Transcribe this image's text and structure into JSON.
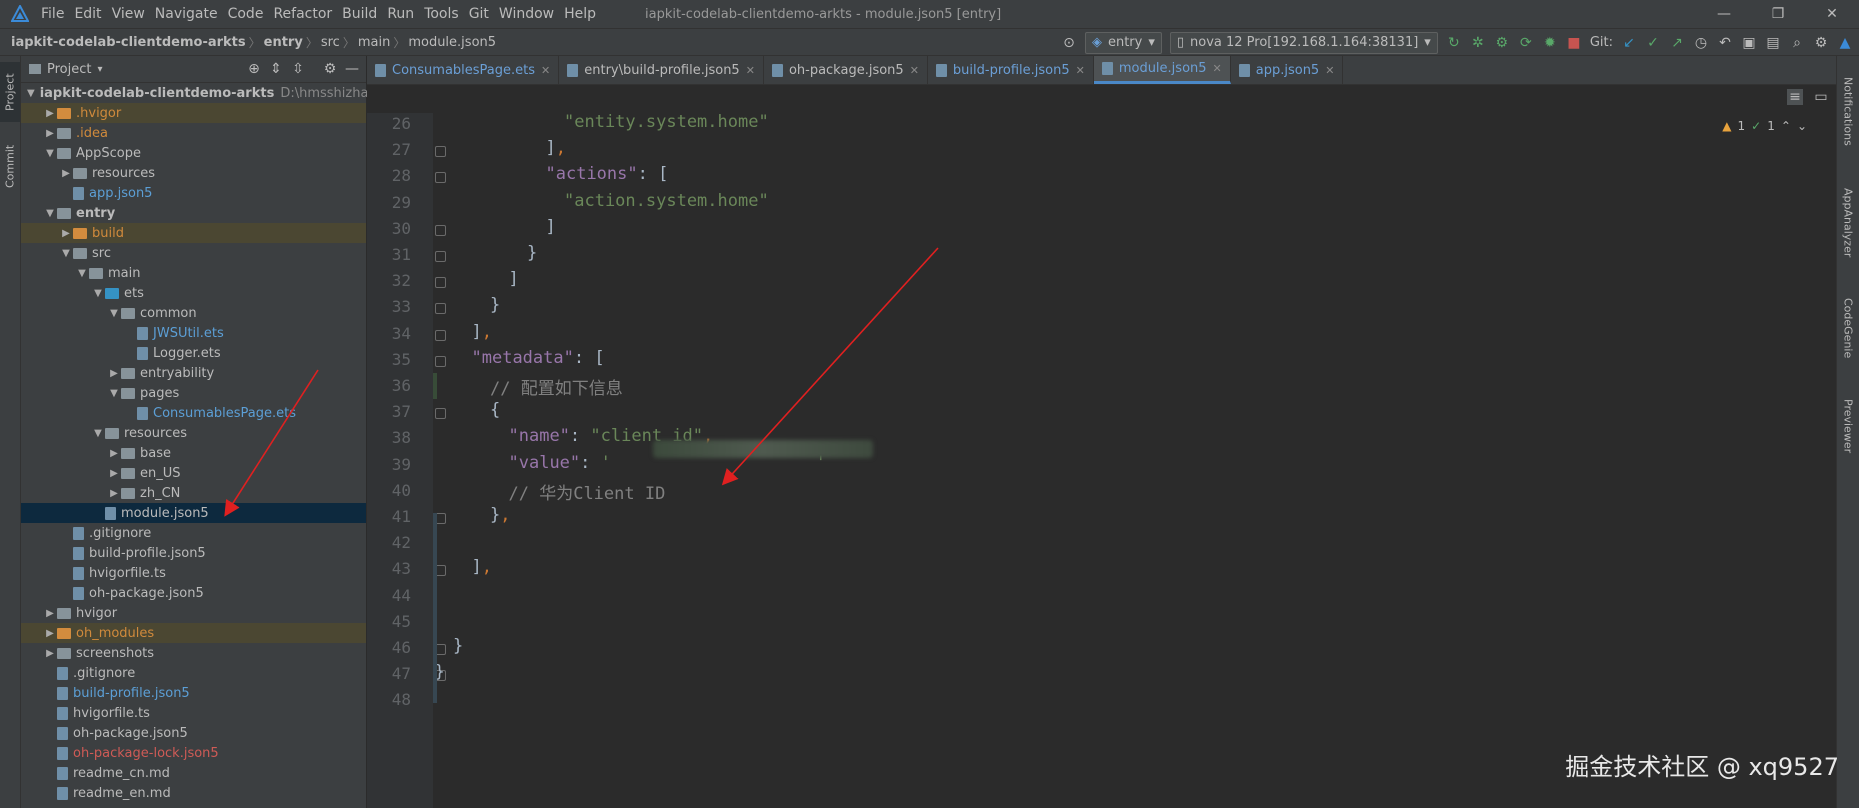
{
  "menu": [
    "File",
    "Edit",
    "View",
    "Navigate",
    "Code",
    "Refactor",
    "Build",
    "Run",
    "Tools",
    "Git",
    "Window",
    "Help"
  ],
  "window_title": "iapkit-codelab-clientdemo-arkts - module.json5 [entry]",
  "breadcrumb": [
    "iapkit-codelab-clientdemo-arkts",
    "entry",
    "src",
    "main",
    "module.json5"
  ],
  "run_config": "entry",
  "device": "nova 12 Pro[192.168.1.164:38131]",
  "git_label": "Git:",
  "panel_title": "Project",
  "left_tabs": [
    "Project",
    "Commit"
  ],
  "right_tabs": [
    "Notifications",
    "AppAnalyzer",
    "CodeGenie",
    "Previewer"
  ],
  "tree": [
    {
      "label": "iapkit-codelab-clientdemo-arkts",
      "suffix": "D:\\hmsshizhande",
      "depth": 0,
      "arrow": "down",
      "type": "folder",
      "bold": true
    },
    {
      "label": ".hvigor",
      "depth": 1,
      "arrow": "right",
      "type": "folder-orange",
      "color": "orange",
      "excl": true
    },
    {
      "label": ".idea",
      "depth": 1,
      "arrow": "right",
      "type": "folder",
      "color": "orange"
    },
    {
      "label": "AppScope",
      "depth": 1,
      "arrow": "down",
      "type": "folder"
    },
    {
      "label": "resources",
      "depth": 2,
      "arrow": "right",
      "type": "folder"
    },
    {
      "label": "app.json5",
      "depth": 2,
      "arrow": "",
      "type": "file",
      "color": "blue"
    },
    {
      "label": "entry",
      "depth": 1,
      "arrow": "down",
      "type": "folder",
      "bold": true
    },
    {
      "label": "build",
      "depth": 2,
      "arrow": "right",
      "type": "folder-orange",
      "color": "orange",
      "excl": true
    },
    {
      "label": "src",
      "depth": 2,
      "arrow": "down",
      "type": "folder"
    },
    {
      "label": "main",
      "depth": 3,
      "arrow": "down",
      "type": "folder"
    },
    {
      "label": "ets",
      "depth": 4,
      "arrow": "down",
      "type": "folder-blue"
    },
    {
      "label": "common",
      "depth": 5,
      "arrow": "down",
      "type": "folder"
    },
    {
      "label": "JWSUtil.ets",
      "depth": 6,
      "arrow": "",
      "type": "file",
      "color": "blue"
    },
    {
      "label": "Logger.ets",
      "depth": 6,
      "arrow": "",
      "type": "file"
    },
    {
      "label": "entryability",
      "depth": 5,
      "arrow": "right",
      "type": "folder"
    },
    {
      "label": "pages",
      "depth": 5,
      "arrow": "down",
      "type": "folder"
    },
    {
      "label": "ConsumablesPage.ets",
      "depth": 6,
      "arrow": "",
      "type": "file",
      "color": "blue"
    },
    {
      "label": "resources",
      "depth": 4,
      "arrow": "down",
      "type": "folder"
    },
    {
      "label": "base",
      "depth": 5,
      "arrow": "right",
      "type": "folder"
    },
    {
      "label": "en_US",
      "depth": 5,
      "arrow": "right",
      "type": "folder"
    },
    {
      "label": "zh_CN",
      "depth": 5,
      "arrow": "right",
      "type": "folder"
    },
    {
      "label": "module.json5",
      "depth": 4,
      "arrow": "",
      "type": "file",
      "selected": true
    },
    {
      "label": ".gitignore",
      "depth": 2,
      "arrow": "",
      "type": "file"
    },
    {
      "label": "build-profile.json5",
      "depth": 2,
      "arrow": "",
      "type": "file"
    },
    {
      "label": "hvigorfile.ts",
      "depth": 2,
      "arrow": "",
      "type": "file"
    },
    {
      "label": "oh-package.json5",
      "depth": 2,
      "arrow": "",
      "type": "file"
    },
    {
      "label": "hvigor",
      "depth": 1,
      "arrow": "right",
      "type": "folder"
    },
    {
      "label": "oh_modules",
      "depth": 1,
      "arrow": "right",
      "type": "folder-orange",
      "color": "orange",
      "excl": true
    },
    {
      "label": "screenshots",
      "depth": 1,
      "arrow": "right",
      "type": "folder"
    },
    {
      "label": ".gitignore",
      "depth": 1,
      "arrow": "",
      "type": "file"
    },
    {
      "label": "build-profile.json5",
      "depth": 1,
      "arrow": "",
      "type": "file",
      "color": "blue"
    },
    {
      "label": "hvigorfile.ts",
      "depth": 1,
      "arrow": "",
      "type": "file"
    },
    {
      "label": "oh-package.json5",
      "depth": 1,
      "arrow": "",
      "type": "file"
    },
    {
      "label": "oh-package-lock.json5",
      "depth": 1,
      "arrow": "",
      "type": "file",
      "color": "red"
    },
    {
      "label": "readme_cn.md",
      "depth": 1,
      "arrow": "",
      "type": "file"
    },
    {
      "label": "readme_en.md",
      "depth": 1,
      "arrow": "",
      "type": "file"
    }
  ],
  "tabs": [
    {
      "label": "ConsumablesPage.ets",
      "active": false,
      "color": "blue"
    },
    {
      "label": "entry\\build-profile.json5",
      "active": false
    },
    {
      "label": "oh-package.json5",
      "active": false
    },
    {
      "label": "build-profile.json5",
      "active": false,
      "color": "blue"
    },
    {
      "label": "module.json5",
      "active": true,
      "color": "blue"
    },
    {
      "label": "app.json5",
      "active": false,
      "color": "blue"
    }
  ],
  "inspections": {
    "warnings": "1",
    "ok": "1"
  },
  "code_lines": [
    {
      "n": "26",
      "indent": 6,
      "parts": [
        [
          "str",
          "\"entity.system.home\""
        ]
      ]
    },
    {
      "n": "27",
      "indent": 5,
      "parts": [
        [
          "plain",
          "]"
        ],
        [
          "punc",
          ","
        ]
      ]
    },
    {
      "n": "28",
      "indent": 5,
      "parts": [
        [
          "key",
          "\"actions\""
        ],
        [
          "plain",
          ": ["
        ]
      ]
    },
    {
      "n": "29",
      "indent": 6,
      "parts": [
        [
          "str",
          "\"action.system.home\""
        ]
      ]
    },
    {
      "n": "30",
      "indent": 5,
      "parts": [
        [
          "plain",
          "]"
        ]
      ]
    },
    {
      "n": "31",
      "indent": 4,
      "parts": [
        [
          "plain",
          "}"
        ]
      ]
    },
    {
      "n": "32",
      "indent": 3,
      "parts": [
        [
          "plain",
          "]"
        ]
      ]
    },
    {
      "n": "33",
      "indent": 2,
      "parts": [
        [
          "plain",
          "}"
        ]
      ]
    },
    {
      "n": "34",
      "indent": 1,
      "parts": [
        [
          "plain",
          "]"
        ],
        [
          "punc",
          ","
        ]
      ]
    },
    {
      "n": "35",
      "indent": 1,
      "parts": [
        [
          "key",
          "\"metadata\""
        ],
        [
          "plain",
          ": ["
        ]
      ]
    },
    {
      "n": "36",
      "indent": 2,
      "parts": [
        [
          "cmt",
          "// 配置如下信息"
        ]
      ]
    },
    {
      "n": "37",
      "indent": 2,
      "parts": [
        [
          "plain",
          "{"
        ]
      ]
    },
    {
      "n": "38",
      "indent": 3,
      "parts": [
        [
          "key",
          "\"name\""
        ],
        [
          "plain",
          ": "
        ],
        [
          "str",
          "\"client_id\""
        ],
        [
          "punc",
          ","
        ]
      ]
    },
    {
      "n": "39",
      "indent": 3,
      "parts": [
        [
          "key",
          "\"value\""
        ],
        [
          "plain",
          ": "
        ],
        [
          "str",
          "'                    '"
        ]
      ]
    },
    {
      "n": "40",
      "indent": 3,
      "parts": [
        [
          "cmt",
          "// 华为Client ID"
        ]
      ]
    },
    {
      "n": "41",
      "indent": 2,
      "parts": [
        [
          "plain",
          "}"
        ],
        [
          "punc",
          ","
        ]
      ]
    },
    {
      "n": "42",
      "indent": 0,
      "parts": []
    },
    {
      "n": "43",
      "indent": 1,
      "parts": [
        [
          "plain",
          "]"
        ],
        [
          "punc",
          ","
        ]
      ]
    },
    {
      "n": "44",
      "indent": 0,
      "parts": []
    },
    {
      "n": "45",
      "indent": 0,
      "parts": []
    },
    {
      "n": "46",
      "indent": 0,
      "parts": [
        [
          "plain",
          "}"
        ]
      ]
    },
    {
      "n": "47",
      "indent": -1,
      "parts": [
        [
          "plain",
          "}"
        ]
      ]
    },
    {
      "n": "48",
      "indent": 0,
      "parts": []
    }
  ],
  "watermark": "掘金技术社区 @ xq9527",
  "colors": {
    "accent": "#4a88c7",
    "arrow": "#e02020"
  }
}
